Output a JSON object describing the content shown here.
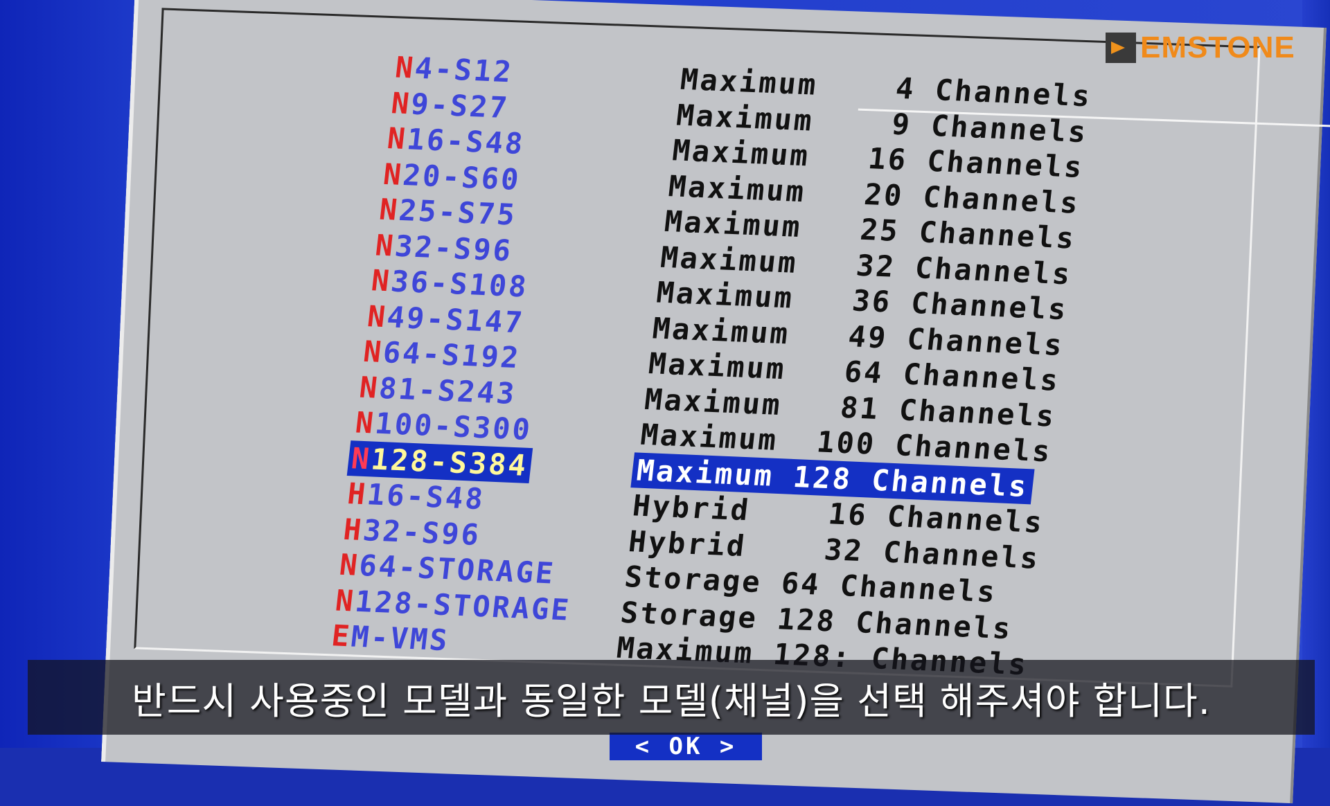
{
  "channel_menu": {
    "items": [
      {
        "key": "N",
        "rest": "4-S12",
        "desc": "Maximum    4 Channels"
      },
      {
        "key": "N",
        "rest": "9-S27",
        "desc": "Maximum    9 Channels"
      },
      {
        "key": "N",
        "rest": "16-S48",
        "desc": "Maximum   16 Channels"
      },
      {
        "key": "N",
        "rest": "20-S60",
        "desc": "Maximum   20 Channels"
      },
      {
        "key": "N",
        "rest": "25-S75",
        "desc": "Maximum   25 Channels"
      },
      {
        "key": "N",
        "rest": "32-S96",
        "desc": "Maximum   32 Channels"
      },
      {
        "key": "N",
        "rest": "36-S108",
        "desc": "Maximum   36 Channels"
      },
      {
        "key": "N",
        "rest": "49-S147",
        "desc": "Maximum   49 Channels"
      },
      {
        "key": "N",
        "rest": "64-S192",
        "desc": "Maximum   64 Channels"
      },
      {
        "key": "N",
        "rest": "81-S243",
        "desc": "Maximum   81 Channels"
      },
      {
        "key": "N",
        "rest": "100-S300",
        "desc": "Maximum  100 Channels"
      },
      {
        "key": "N",
        "rest": "128-S384",
        "desc": "Maximum 128 Channels",
        "selected": true
      },
      {
        "key": "H",
        "rest": "16-S48",
        "desc": "Hybrid    16 Channels"
      },
      {
        "key": "H",
        "rest": "32-S96",
        "desc": "Hybrid    32 Channels"
      },
      {
        "key": "N",
        "rest": "64-STORAGE",
        "desc": "Storage 64 Channels"
      },
      {
        "key": "N",
        "rest": "128-STORAGE",
        "desc": "Storage 128 Channels"
      },
      {
        "key": "E",
        "rest": "M-VMS",
        "desc": "Maximum 128: Channels"
      }
    ],
    "ok_label": "< OK >"
  },
  "subtitle": "반드시 사용중인 모델과 동일한 모델(채널)을 선택 해주셔야 합니다.",
  "logo_text": "EMSTONE",
  "colors": {
    "highlight": "#1430c4",
    "hotkey": "#e02323",
    "code_text": "#3e46d8",
    "dialog_bg": "#c2c4c8",
    "logo": "#f08a1a"
  }
}
